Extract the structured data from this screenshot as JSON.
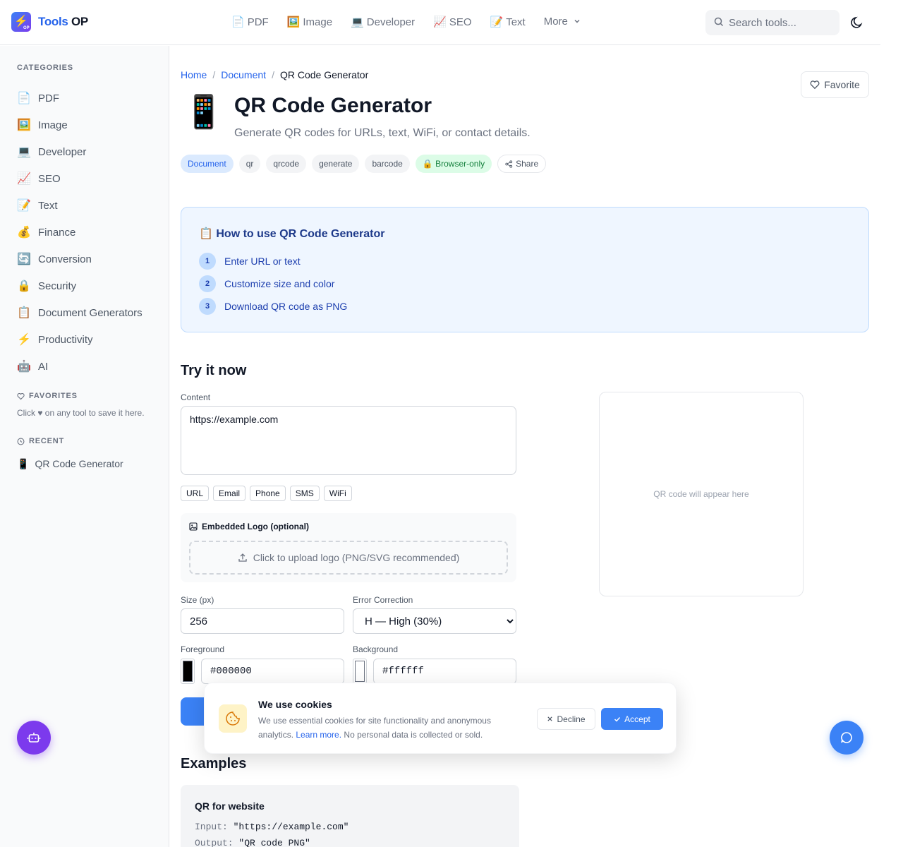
{
  "header": {
    "logo_badge": "⚡",
    "logo_badge_sub": "OP",
    "logo_word1": "Tools",
    "logo_word2": " OP",
    "nav": [
      {
        "icon": "📄",
        "label": "PDF"
      },
      {
        "icon": "🖼️",
        "label": "Image"
      },
      {
        "icon": "💻",
        "label": "Developer"
      },
      {
        "icon": "📈",
        "label": "SEO"
      },
      {
        "icon": "📝",
        "label": "Text"
      },
      {
        "icon": "",
        "label": "More"
      }
    ],
    "search_placeholder": "Search tools..."
  },
  "sidebar": {
    "categories_heading": "CATEGORIES",
    "items": [
      {
        "icon": "📄",
        "label": "PDF"
      },
      {
        "icon": "🖼️",
        "label": "Image"
      },
      {
        "icon": "💻",
        "label": "Developer"
      },
      {
        "icon": "📈",
        "label": "SEO"
      },
      {
        "icon": "📝",
        "label": "Text"
      },
      {
        "icon": "💰",
        "label": "Finance"
      },
      {
        "icon": "🔄",
        "label": "Conversion"
      },
      {
        "icon": "🔒",
        "label": "Security"
      },
      {
        "icon": "📋",
        "label": "Document Generators"
      },
      {
        "icon": "⚡",
        "label": "Productivity"
      },
      {
        "icon": "🤖",
        "label": "AI"
      }
    ],
    "favorites_heading": "FAVORITES",
    "favorites_note": "Click ♥ on any tool to save it here.",
    "recent_heading": "RECENT",
    "recent_item": {
      "icon": "📱",
      "label": "QR Code Generator"
    }
  },
  "main": {
    "breadcrumb": {
      "home": "Home",
      "section": "Document",
      "current": "QR Code Generator",
      "sep": "/"
    },
    "favorite_label": "Favorite",
    "tool_icon": "📱",
    "title": "QR Code Generator",
    "description": "Generate QR codes for URLs, text, WiFi, or contact details.",
    "tags": {
      "category": "Document",
      "keywords": [
        "qr",
        "qrcode",
        "generate",
        "barcode"
      ],
      "browser_only": "🔒 Browser-only",
      "share": "Share"
    },
    "howto": {
      "title": "📋 How to use QR Code Generator",
      "steps": [
        {
          "num": "1",
          "text": "Enter URL or text"
        },
        {
          "num": "2",
          "text": "Customize size and color"
        },
        {
          "num": "3",
          "text": "Download QR code as PNG"
        }
      ]
    },
    "try_title": "Try it now",
    "form": {
      "content_label": "Content",
      "content_value": "https://example.com",
      "presets": [
        "URL",
        "Email",
        "Phone",
        "SMS",
        "WiFi"
      ],
      "logo_title": "Embedded Logo (optional)",
      "upload_text": "Click to upload logo (PNG/SVG recommended)",
      "size_label": "Size (px)",
      "size_value": "256",
      "ec_label": "Error Correction",
      "ec_value": "H — High (30%)",
      "fg_label": "Foreground",
      "fg_value": "#000000",
      "bg_label": "Background",
      "bg_value": "#ffffff"
    },
    "preview_placeholder": "QR code will appear here",
    "examples": {
      "title": "Examples",
      "card_title": "QR for website",
      "input_key": "Input:",
      "input_val": "\"https://example.com\"",
      "output_key": "Output:",
      "output_val": "\"QR code PNG\""
    }
  },
  "cookie": {
    "title": "We use cookies",
    "body_pre": "We use essential cookies for site functionality and anonymous analytics. ",
    "learn_more": "Learn more.",
    "body_post": " No personal data is collected or sold.",
    "decline": "Decline",
    "accept": "Accept"
  },
  "colors": {
    "accent": "#3b82f6",
    "brand_purple": "#7c3aed",
    "foreground_swatch": "#000000",
    "background_swatch": "#ffffff"
  }
}
